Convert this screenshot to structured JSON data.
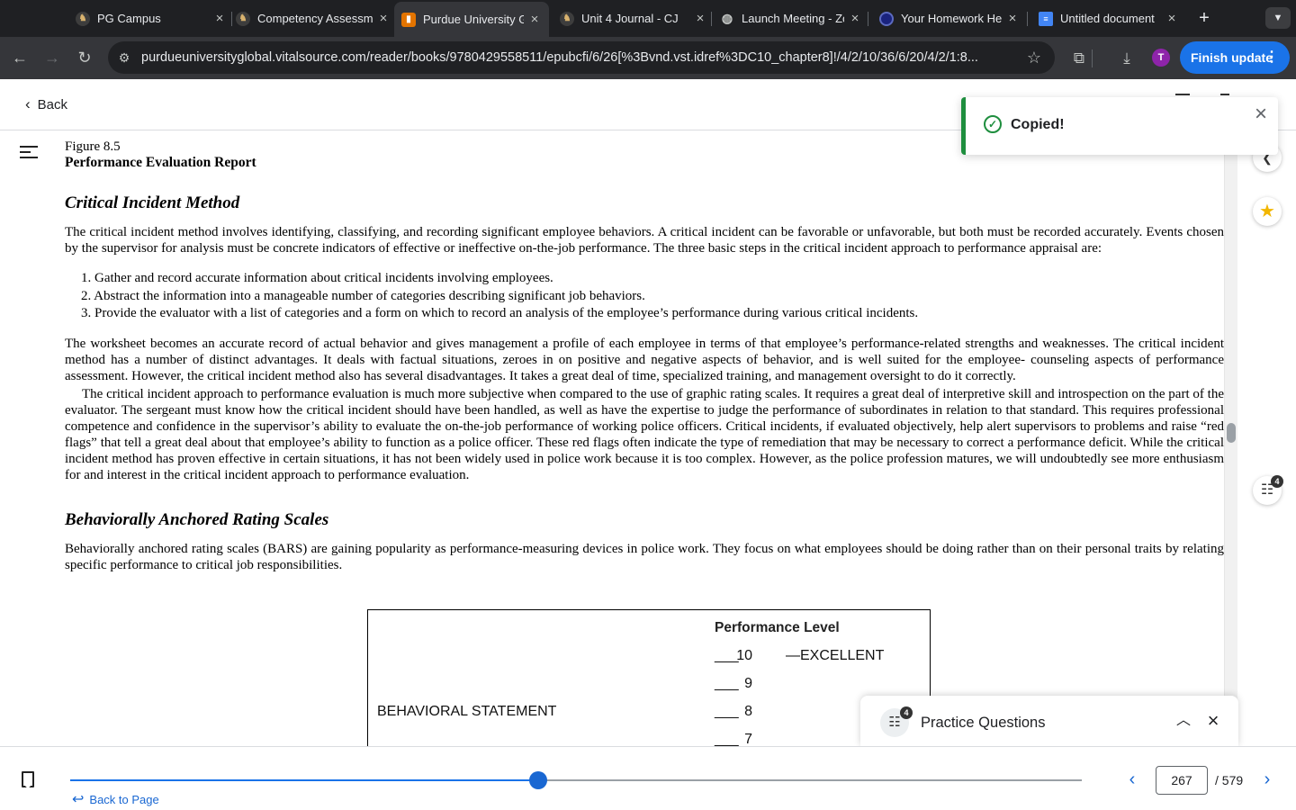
{
  "browser": {
    "tabs": [
      {
        "title": "PG Campus",
        "active": false
      },
      {
        "title": "Competency Assessment",
        "active": false
      },
      {
        "title": "Purdue University Global",
        "active": true
      },
      {
        "title": "Unit 4 Journal - CJ",
        "active": false
      },
      {
        "title": "Launch Meeting - Zoom",
        "active": false
      },
      {
        "title": "Your Homework Help",
        "active": false
      },
      {
        "title": "Untitled document",
        "active": false
      }
    ],
    "new_tab": "+",
    "url": "purdueuniversityglobal.vitalsource.com/reader/books/9780429558511/epubcfi/6/26[%3Bvnd.vst.idref%3DC10_chapter8]!/4/2/10/36/6/20/4/2/1:8...",
    "profile_initial": "T",
    "finish_update_label": "Finish update"
  },
  "reader": {
    "back_label": "Back",
    "toast": {
      "message": "Copied!"
    },
    "figure_caption": "Figure 8.5",
    "figure_title": "Performance Evaluation Report",
    "section1": {
      "heading": "Critical Incident Method",
      "intro": "The critical incident method involves identifying, classifying, and recording significant employee behaviors. A critical incident can be favorable or unfavorable, but both must be recorded accurately. Events chosen by the supervisor for analysis must be concrete indicators of effective or ineffective on-the-job performance. The three basic steps in the critical incident approach to performance appraisal are:",
      "steps": [
        "1.  Gather and record accurate information about critical incidents involving employees.",
        "2.  Abstract the information into a manageable number of categories describing significant job behaviors.",
        "3.  Provide the evaluator with a list of categories and a form on which to record an analysis of the employee’s performance during various critical incidents."
      ],
      "para2": "The worksheet becomes an accurate record of actual behavior and gives management a profile of each employee in terms of that employee’s performance-related strengths and weaknesses. The critical incident method has a number of distinct advantages. It deals with factual situations, zeroes in on positive and negative aspects of behavior, and is well suited for the employee- counseling aspects of performance assessment. However, the critical incident method also has several disadvantages. It takes a great deal of time, specialized training, and management oversight to do it correctly.",
      "para3": "The critical incident approach to performance evaluation is much more subjective when compared to the use of graphic rating scales. It requires a great deal of interpretive skill and introspection on the part of the evaluator. The sergeant must know how the critical incident should have been handled, as well as have the expertise to judge the performance of subordinates in relation to that standard. This requires professional competence and confidence in the supervisor’s ability to evaluate the on-the-job performance of working police officers. Critical incidents, if evaluated objectively, help alert supervisors to problems and raise “red flags” that tell a great deal about that employee’s ability to function as a police officer. These red flags often indicate the type of remediation that may be necessary to correct a performance deficit. While the critical incident method has proven effective in certain situations, it has not been widely used in police work because it is too complex. However, as the police profession matures, we will undoubtedly see more enthusiasm for and interest in the critical incident approach to performance evaluation."
    },
    "section2": {
      "heading": "Behaviorally Anchored Rating Scales",
      "intro": "Behaviorally anchored rating scales (BARS) are gaining popularity as performance-measuring devices in police work. They focus on what employees should be doing rather than on their personal traits by relating specific performance to critical job responsibilities."
    },
    "bars_figure": {
      "performance_title": "Performance Level",
      "statement_label": "BEHAVIORAL STATEMENT",
      "levels": [
        {
          "blank": "___",
          "num": "10",
          "label": "—EXCELLENT"
        },
        {
          "blank": "___",
          "num": "9",
          "label": ""
        },
        {
          "blank": "___",
          "num": "8",
          "label": ""
        },
        {
          "blank": "___",
          "num": "7",
          "label": ""
        }
      ]
    },
    "practice_panel": {
      "title": "Practice Questions",
      "badge": "4"
    },
    "rail_badge": "4",
    "bottom": {
      "back_to_page_label": "Back to Page",
      "current_page": "267",
      "total_pages": "/ 579",
      "progress": 0.4626
    }
  },
  "colors": {
    "accent": "#1a73e8",
    "toast_success": "#1e8e3e",
    "star": "#f2b600"
  },
  "icons": {
    "back": "chevron-left-icon",
    "menu": "hamburger-menu-icon",
    "toast": "check-circle-icon",
    "close": "close-icon",
    "rail_top": "chevron-left-icon",
    "rail_star": "star-icon",
    "rail_pq": "practice-questions-icon",
    "bookmark": "bookmark-icon",
    "prev": "chevron-left-icon",
    "next": "chevron-right-icon"
  }
}
